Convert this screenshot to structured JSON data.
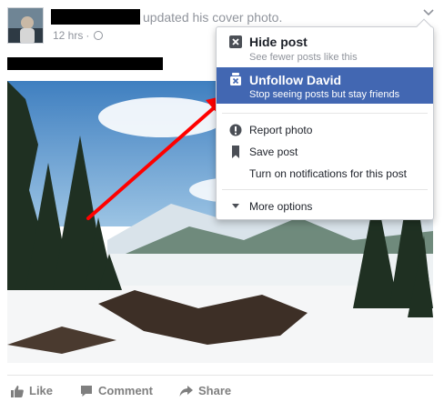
{
  "post": {
    "action_text": "updated his cover photo.",
    "time": "12 hrs",
    "time_separator": "·"
  },
  "menu": {
    "hide": {
      "title": "Hide post",
      "subtitle": "See fewer posts like this"
    },
    "unfollow": {
      "title": "Unfollow David",
      "subtitle": "Stop seeing posts but stay friends"
    },
    "report": "Report photo",
    "save": "Save post",
    "notifications": "Turn on notifications for this post",
    "more": "More options"
  },
  "actions": {
    "like": "Like",
    "comment": "Comment",
    "share": "Share"
  },
  "colors": {
    "highlight": "#4267b2",
    "arrow": "#ff0000",
    "muted_text": "#90949c"
  },
  "icons": [
    "close-box-icon",
    "unfollow-icon",
    "report-icon",
    "bookmark-icon",
    "caret-down-icon",
    "globe-icon",
    "thumbs-up-icon",
    "comment-icon",
    "share-icon"
  ]
}
